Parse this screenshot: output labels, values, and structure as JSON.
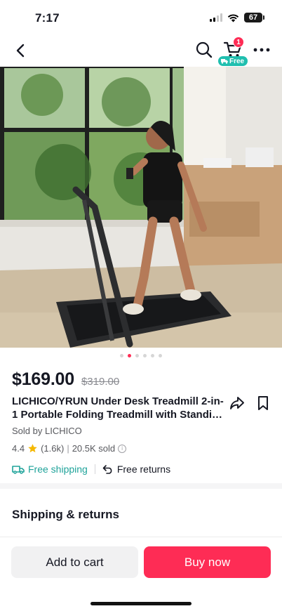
{
  "status_bar": {
    "time": "7:17",
    "battery": "67"
  },
  "nav": {
    "cart_count": "1",
    "cart_free_label": "Free"
  },
  "carousel": {
    "dot_count": 6,
    "active_index": 1
  },
  "product": {
    "price": "$169.00",
    "original_price": "$319.00",
    "title": "LICHICO/YRUN Under Desk Treadmill 2-in-1 Portable Folding Treadmill with Standing Desk Rail",
    "sold_by": "Sold by LICHICO",
    "rating": "4.4",
    "rating_count": "(1.6k)",
    "sold_count": "20.5K sold",
    "separator": "|",
    "free_shipping": "Free shipping",
    "free_returns": "Free returns"
  },
  "sections": {
    "shipping_title": "Shipping & returns"
  },
  "actions": {
    "add_to_cart": "Add to cart",
    "buy_now": "Buy now"
  },
  "colors": {
    "accent": "#fe2c55",
    "teal": "#20bfaf",
    "shipping_text": "#1fa39a"
  }
}
